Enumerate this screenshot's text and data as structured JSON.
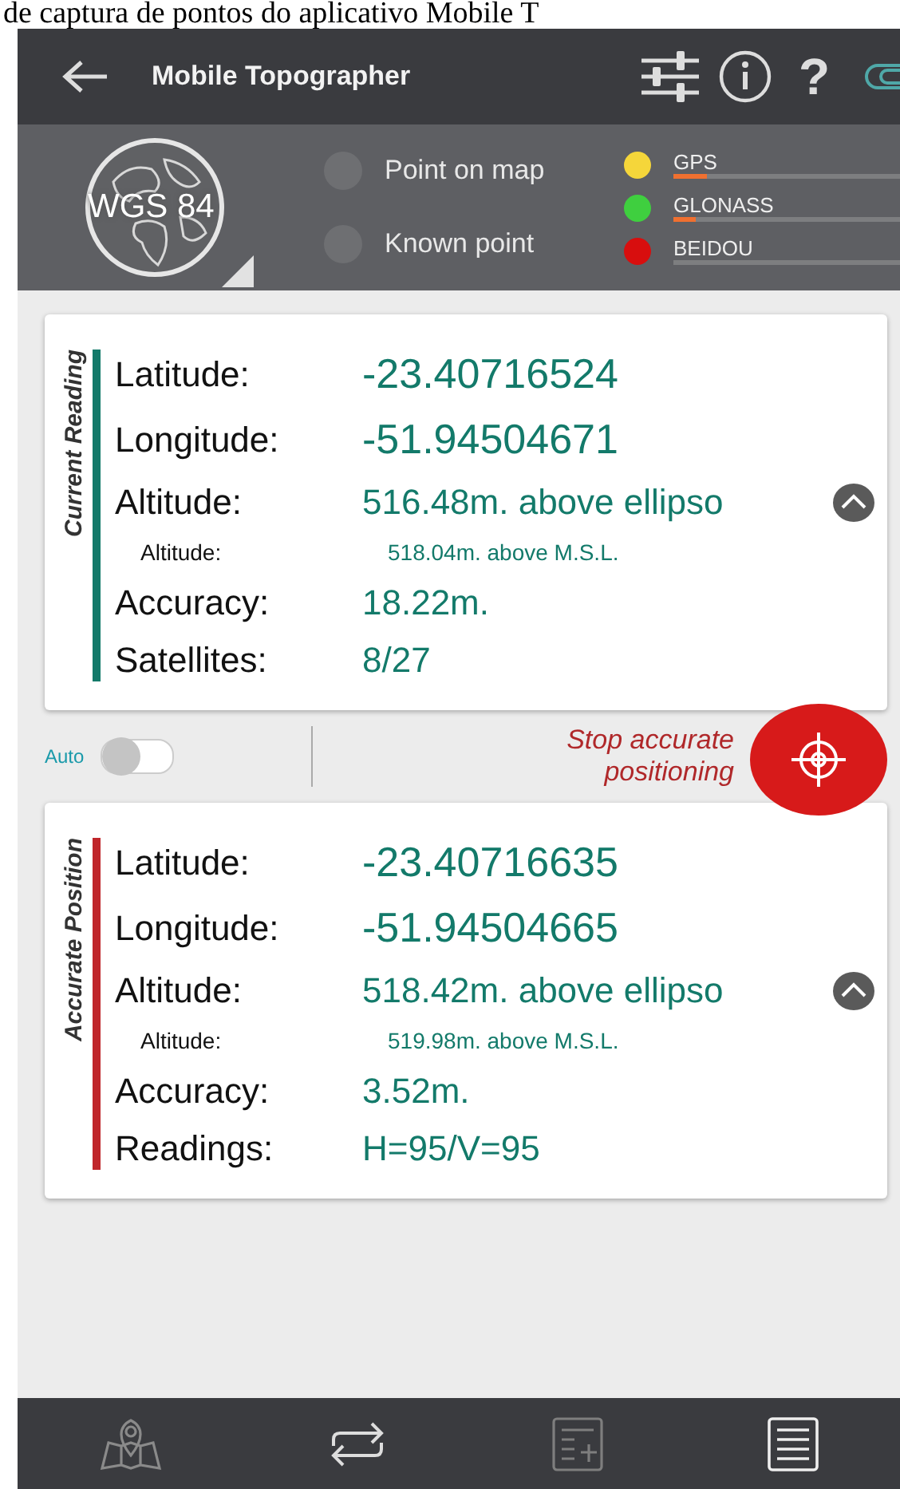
{
  "caption": "de captura de pontos do aplicativo Mobile T",
  "app_bar": {
    "title": "Mobile Topographer",
    "help": "?"
  },
  "datum": {
    "label": "WGS 84"
  },
  "point_source": [
    {
      "label": "Point on map",
      "selected": false
    },
    {
      "label": "Known point",
      "selected": false
    }
  ],
  "constellations": [
    {
      "name": "GPS",
      "color": "#f5d63a",
      "level": 0.15
    },
    {
      "name": "GLONASS",
      "color": "#3fcf3f",
      "level": 0.1
    },
    {
      "name": "BEIDOU",
      "color": "#d80e0e"
    }
  ],
  "cards": [
    {
      "title": "Current Reading",
      "color": "#137a6a",
      "rows": [
        {
          "kind": "coord",
          "label": "Latitude:",
          "value": "-23.40716524"
        },
        {
          "kind": "coord",
          "label": "Longitude:",
          "value": "-51.94504671"
        },
        {
          "kind": "main",
          "label": "Altitude:",
          "value": "516.48m. above ellipso",
          "expand": true
        },
        {
          "kind": "sub",
          "label": "Altitude:",
          "value": "518.04m. above M.S.L."
        },
        {
          "kind": "main",
          "label": "Accuracy:",
          "value": "18.22m."
        },
        {
          "kind": "main",
          "label": "Satellites:",
          "value": "8/27"
        }
      ]
    },
    {
      "title": "Accurate Position",
      "color": "#c0262b",
      "rows": [
        {
          "kind": "coord",
          "label": "Latitude:",
          "value": "-23.40716635"
        },
        {
          "kind": "coord",
          "label": "Longitude:",
          "value": "-51.94504665"
        },
        {
          "kind": "main",
          "label": "Altitude:",
          "value": "518.42m. above ellipso",
          "expand": true
        },
        {
          "kind": "sub",
          "label": "Altitude:",
          "value": "519.98m. above M.S.L."
        },
        {
          "kind": "main",
          "label": "Accuracy:",
          "value": "3.52m."
        },
        {
          "kind": "main",
          "label": "Readings:",
          "value": "H=95/V=95"
        }
      ]
    }
  ],
  "controls": {
    "auto_label": "Auto",
    "auto_on": false,
    "action": "Stop accurate positioning"
  }
}
